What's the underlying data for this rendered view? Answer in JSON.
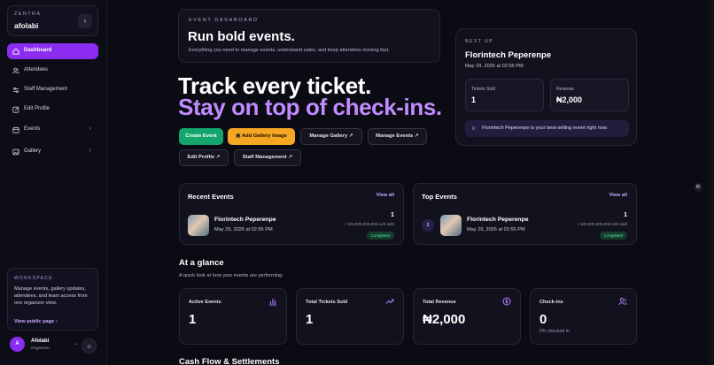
{
  "sidebar": {
    "brand_kicker": "ZENTRA",
    "brand_name": "afolabi",
    "collapse_icon": "chevron-left-icon",
    "items": [
      {
        "label": "Dashboard",
        "icon": "home-icon",
        "active": true
      },
      {
        "label": "Attendees",
        "icon": "users-icon"
      },
      {
        "label": "Staff Management",
        "icon": "sliders-icon"
      },
      {
        "label": "Edit Profile",
        "icon": "edit-icon"
      },
      {
        "label": "Events",
        "icon": "calendar-icon",
        "expandable": true
      },
      {
        "label": "Gallery",
        "icon": "image-icon",
        "expandable": true
      }
    ],
    "workspace": {
      "kicker": "WORKSPACE",
      "text": "Manage events, gallery updates, attendees, and team access from one organizer view.",
      "link": "View public page"
    },
    "user": {
      "initial": "A",
      "name": "Afolabi",
      "role": "Organizer"
    }
  },
  "header": {
    "kicker": "EVENT DASHBOARD",
    "title": "Run bold events.",
    "subtitle": "Everything you need to manage events, understand sales, and keep attendees moving fast."
  },
  "hero": {
    "line1": "Track every ticket.",
    "line2": "Stay on top of check-ins."
  },
  "actions": {
    "create_event": "Create Event",
    "add_gallery_image": "Add Gallery Image",
    "manage_gallery": "Manage Gallery",
    "manage_events": "Manage Events",
    "edit_profile": "Edit Profile",
    "staff_management": "Staff Management",
    "external_arrow": "↗"
  },
  "next_up": {
    "kicker": "NEXT UP",
    "title": "Florintech Peperenpe",
    "date": "May 29, 2026 at 02:55 PM",
    "tickets_sold_label": "Tickets Sold",
    "tickets_sold_value": "1",
    "revenue_label": "Revenue",
    "revenue_value": "₦2,000",
    "note": "Florintech Peperenpe is your best-selling event right now."
  },
  "recent_events": {
    "title": "Recent Events",
    "view_all": "View all",
    "item": {
      "title": "Florintech Peperenpe",
      "date": "May 29, 2026 at 02:55 PM",
      "count": "1",
      "sold": "/ 100,000,000,000,125 sold",
      "status": "Completed"
    }
  },
  "top_events": {
    "title": "Top Events",
    "view_all": "View all",
    "item": {
      "rank": "1",
      "title": "Florintech Peperenpe",
      "date": "May 29, 2026 at 02:55 PM",
      "count": "1",
      "sold": "/ 100,000,000,000,125 sold",
      "status": "Completed"
    }
  },
  "glance": {
    "title": "At a glance",
    "subtitle": "A quick look at how your events are performing.",
    "stats": [
      {
        "label": "Active Events",
        "value": "1",
        "icon": "bar-chart-icon"
      },
      {
        "label": "Total Tickets Sold",
        "value": "1",
        "icon": "trending-up-icon"
      },
      {
        "label": "Total Revenue",
        "value": "₦2,000",
        "icon": "dollar-circle-icon"
      },
      {
        "label": "Check-ins",
        "value": "0",
        "icon": "people-icon",
        "foot": "0% checked in"
      }
    ]
  },
  "next_section_title": "Cash Flow & Settlements",
  "colors": {
    "accent": "#8b2cf0",
    "accent_light": "#c08bff",
    "success": "#13a56b",
    "warning": "#f5a623",
    "background": "#0b0b14"
  }
}
